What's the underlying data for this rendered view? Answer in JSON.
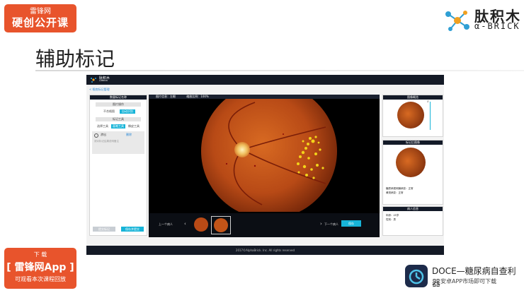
{
  "badge_top": {
    "line1": "雷锋网",
    "line2": "硬创公开课"
  },
  "logo": {
    "cn": "肽积木",
    "en": "α-BRICK"
  },
  "slide_title": "辅助标记",
  "app": {
    "brand": "肽积木",
    "brand_sub": "α-BRICK",
    "breadcrumb": "< 眼底标记管理",
    "left_panel": {
      "title": "数量标记名称",
      "section1": "图片操作",
      "btn_a": "不合格图",
      "btn_b": "自动识别",
      "section2": "标记工具",
      "tool_1": "选择工具",
      "tool_2": "画笔工具",
      "tool_3": "橡皮工具",
      "label_item": "渗出",
      "label_link": "删除",
      "note_placeholder": "请对标记结果说明备注",
      "bottom_btn_1": "提交标记",
      "bottom_btn_2": "保存并提交"
    },
    "center": {
      "info_left": "图片信息：左眼",
      "info_zoom": "缩放比例：100%",
      "prev": "上一个病人",
      "next": "下一个病人",
      "save": "保存"
    },
    "right": {
      "panel1_title": "图像概览",
      "panel2_title": "标记后图像",
      "result1": "糖尿病视网膜病变：正常",
      "result2": "黄斑病变：正常",
      "panel3_title": "病人信息",
      "age": "年龄：45岁",
      "sex": "性别：男"
    },
    "footer": "2017©AlphaBrick. Inc. All rights reserved"
  },
  "badge_bottom": {
    "line1": "下 载",
    "line2": "[ 雷锋网App ]",
    "line3": "可观看本次课程回放"
  },
  "doce": {
    "name": "DOCE—糖尿病自查利器",
    "sub": "安卓APP市场即可下载"
  },
  "colors": {
    "brand_orange": "#e8542c",
    "app_dark": "#131a28",
    "accent_cyan": "#17b4d8",
    "lesion_yellow": "#f3d31a"
  },
  "icons": [
    "molecule-logo-icon",
    "prev-chevron-icon",
    "next-chevron-icon",
    "radio-icon",
    "magnifier-icon"
  ]
}
